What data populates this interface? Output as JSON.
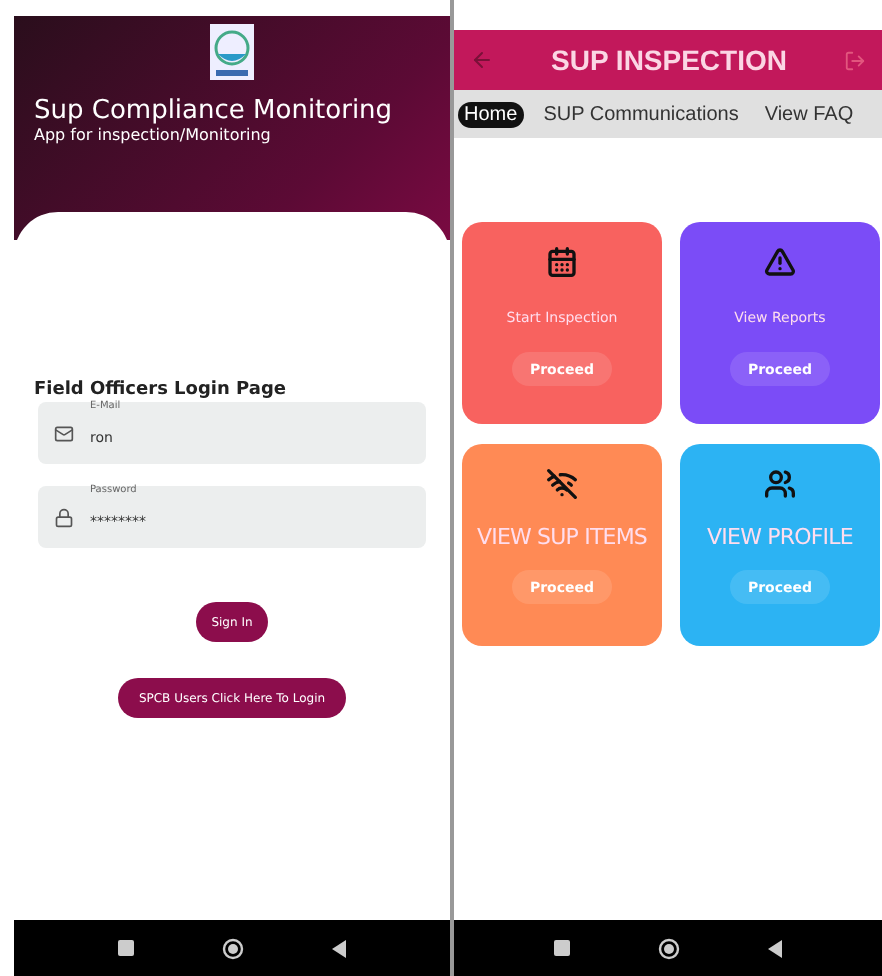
{
  "login_screen": {
    "title": "Sup Compliance Monitoring",
    "subtitle": "App for inspection/Monitoring",
    "heading": "Field Officers Login Page",
    "fields": [
      {
        "kind": "email",
        "label": "E-Mail",
        "value": "ron"
      },
      {
        "kind": "password",
        "label": "Password",
        "value": "********"
      }
    ],
    "sign_in_button": "Sign In",
    "spcb_button": "SPCB Users Click Here To Login"
  },
  "inspection_screen": {
    "title": "SUP INSPECTION",
    "tabs": [
      {
        "label": "Home",
        "selected": true
      },
      {
        "label": "SUP Communications",
        "selected": false
      },
      {
        "label": "View FAQ",
        "selected": false
      }
    ],
    "cards": [
      {
        "kind": "calendar",
        "title": "Start Inspection",
        "button": "Proceed",
        "color": "#f8625f",
        "large": false
      },
      {
        "kind": "warning",
        "title": "View Reports",
        "button": "Proceed",
        "color": "#7b4cf7",
        "large": false
      },
      {
        "kind": "signal",
        "title": "VIEW SUP ITEMS",
        "button": "Proceed",
        "color": "#ff8a55",
        "large": true
      },
      {
        "kind": "face",
        "title": "VIEW PROFILE",
        "button": "Proceed",
        "color": "#2cb3f3",
        "large": true
      }
    ]
  }
}
